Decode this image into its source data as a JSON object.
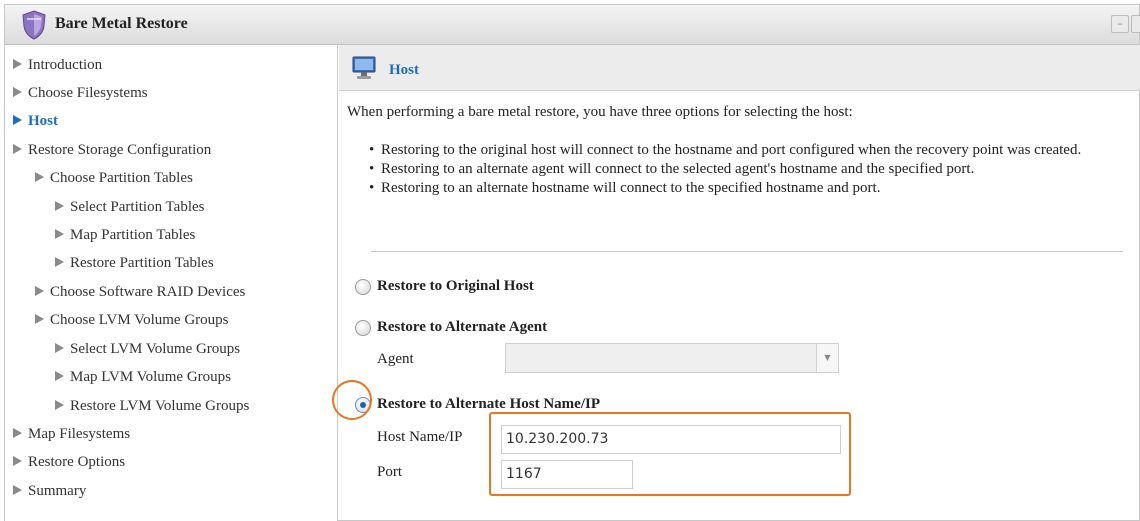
{
  "window": {
    "title": "Bare Metal Restore"
  },
  "sidebar": {
    "items": [
      {
        "label": "Introduction"
      },
      {
        "label": "Choose Filesystems"
      },
      {
        "label": "Host"
      },
      {
        "label": "Restore Storage Configuration"
      },
      {
        "label": "Choose Partition Tables"
      },
      {
        "label": "Select Partition Tables"
      },
      {
        "label": "Map Partition Tables"
      },
      {
        "label": "Restore Partition Tables"
      },
      {
        "label": "Choose Software RAID Devices"
      },
      {
        "label": "Choose LVM Volume Groups"
      },
      {
        "label": "Select LVM Volume Groups"
      },
      {
        "label": "Map LVM Volume Groups"
      },
      {
        "label": "Restore LVM Volume Groups"
      },
      {
        "label": "Map Filesystems"
      },
      {
        "label": "Restore Options"
      },
      {
        "label": "Summary"
      }
    ],
    "active": "Host"
  },
  "content": {
    "title": "Host",
    "intro": "When performing a bare metal restore, you have three options for selecting the host:",
    "bullets": [
      "Restoring to the original host will connect to the hostname and port configured when the recovery point was created.",
      "Restoring to an alternate agent will connect to the selected agent's hostname and the specified port.",
      "Restoring to an alternate hostname will connect to the specified hostname and port."
    ],
    "options": {
      "original": {
        "label": "Restore to Original Host",
        "selected": false
      },
      "agent": {
        "label": "Restore to Alternate Agent",
        "selected": false,
        "agent_label": "Agent",
        "agent_value": ""
      },
      "hostname": {
        "label": "Restore to Alternate Host Name/IP",
        "selected": true,
        "host_label": "Host Name/IP",
        "host_value": "10.230.200.73",
        "port_label": "Port",
        "port_value": "1167"
      }
    }
  },
  "icons": {
    "app": "shield-icon",
    "host": "monitor-icon",
    "nav_arrow": "triangle-right-icon",
    "select_arrow": "chevron-down-icon"
  },
  "colors": {
    "accent": "#1d6cc0",
    "highlight": "#e87722"
  }
}
